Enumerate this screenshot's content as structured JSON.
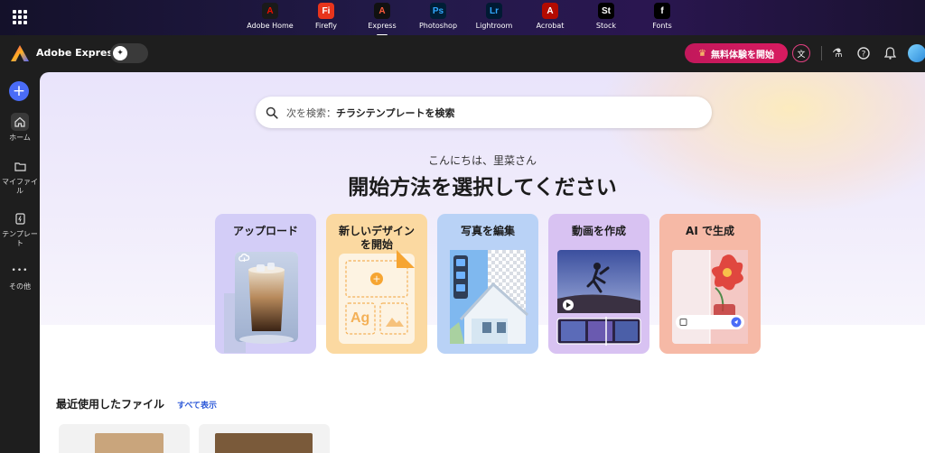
{
  "appbar": {
    "apps": [
      {
        "label": "Adobe Home",
        "glyph": "A",
        "color": "#1a1a1a",
        "fg": "#eb1000",
        "icon": "adobe-home-icon"
      },
      {
        "label": "Firefly",
        "glyph": "Fi",
        "color": "#e8341c",
        "fg": "#ffffff",
        "icon": "firefly-icon"
      },
      {
        "label": "Express",
        "glyph": "A",
        "color": "#111111",
        "fg": "#ff5a3c",
        "icon": "express-icon"
      },
      {
        "label": "Photoshop",
        "glyph": "Ps",
        "color": "#001e36",
        "fg": "#31a8ff",
        "icon": "photoshop-icon"
      },
      {
        "label": "Lightroom",
        "glyph": "Lr",
        "color": "#001a33",
        "fg": "#31a8ff",
        "icon": "lightroom-icon"
      },
      {
        "label": "Acrobat",
        "glyph": "A",
        "color": "#b30b00",
        "fg": "#ffffff",
        "icon": "acrobat-icon"
      },
      {
        "label": "Stock",
        "glyph": "St",
        "color": "#000000",
        "fg": "#ffffff",
        "icon": "stock-icon"
      },
      {
        "label": "Fonts",
        "glyph": "f",
        "color": "#000000",
        "fg": "#ffffff",
        "icon": "fonts-icon"
      }
    ],
    "active": "Express"
  },
  "header": {
    "brand": "Adobe Express",
    "trial_button": "無料体験を開始",
    "accent": "#d81b60"
  },
  "rail": {
    "items": [
      {
        "label": "ホーム",
        "icon": "home-icon",
        "glyph": "⌂"
      },
      {
        "label": "マイファイル",
        "icon": "folder-icon",
        "glyph": "▭"
      },
      {
        "label": "テンプレート",
        "icon": "template-icon",
        "glyph": "⧈"
      },
      {
        "label": "その他",
        "icon": "more-icon",
        "glyph": "•••"
      }
    ]
  },
  "search": {
    "prefix": "次を検索：",
    "suggestion": "チラシテンプレートを検索"
  },
  "greeting": "こんにちは、里菜さん",
  "headline": "開始方法を選択してください",
  "cards": [
    {
      "title": "アップロード"
    },
    {
      "title": "新しいデザイン\nを開始",
      "ag": "Ag"
    },
    {
      "title": "写真を編集"
    },
    {
      "title": "動画を作成"
    },
    {
      "title": "AI で生成"
    }
  ],
  "recent": {
    "title": "最近使用したファイル",
    "show_all": "すべて表示"
  }
}
